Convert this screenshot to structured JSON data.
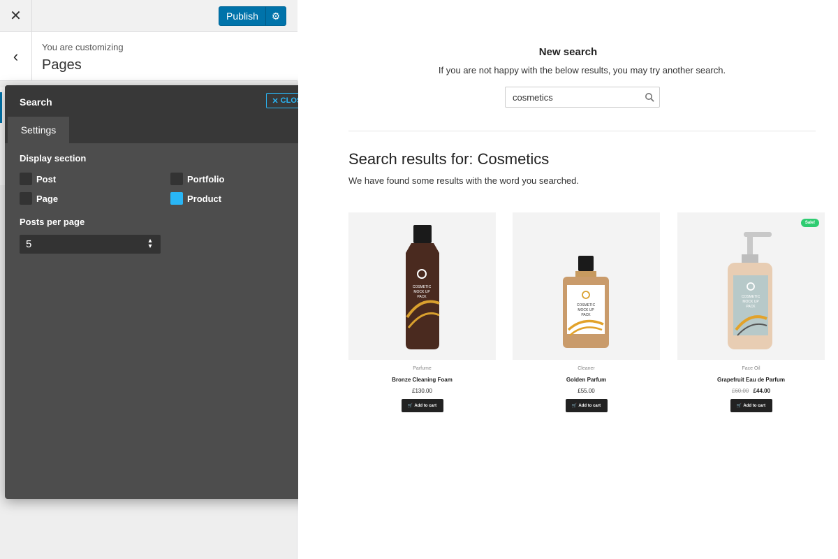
{
  "customizer": {
    "close_icon": "close-icon",
    "publish_label": "Publish",
    "publish_settings_icon": "gear-icon",
    "back_icon": "chevron-left-icon",
    "customizing_label": "You are customizing",
    "section_title": "Pages",
    "accent_color": "#0073aa"
  },
  "panel": {
    "title": "Search",
    "close_label": "CLOSE",
    "tab_label": "Settings",
    "display_section_label": "Display section",
    "options": [
      {
        "label": "Post",
        "checked": false
      },
      {
        "label": "Portfolio",
        "checked": false
      },
      {
        "label": "Page",
        "checked": false
      },
      {
        "label": "Product",
        "checked": true
      }
    ],
    "posts_per_page_label": "Posts per page",
    "posts_per_page_value": "5",
    "accent_color": "#29b6f6"
  },
  "preview": {
    "new_search_title": "New search",
    "new_search_desc": "If you are not happy with the below results, you may try another search.",
    "search_value": "cosmetics",
    "results_title": "Search results for:  Cosmetics",
    "results_desc": "We have found some results with the word you searched.",
    "products": [
      {
        "category": "Parfume",
        "name": "Bronze Cleaning Foam",
        "price": "£130.00",
        "old_price": "",
        "sale": false,
        "cart_label": "Add to cart"
      },
      {
        "category": "Cleaner",
        "name": "Golden Parfum",
        "price": "£55.00",
        "old_price": "",
        "sale": false,
        "cart_label": "Add to cart"
      },
      {
        "category": "Face Oil",
        "name": "Grapefruit Eau de Parfum",
        "price": "£44.00",
        "old_price": "£60.00",
        "sale": true,
        "sale_label": "Sale!",
        "cart_label": "Add to cart"
      }
    ],
    "bottle_label": [
      "COSMETIC",
      "MOCK UP",
      "PACK"
    ]
  }
}
